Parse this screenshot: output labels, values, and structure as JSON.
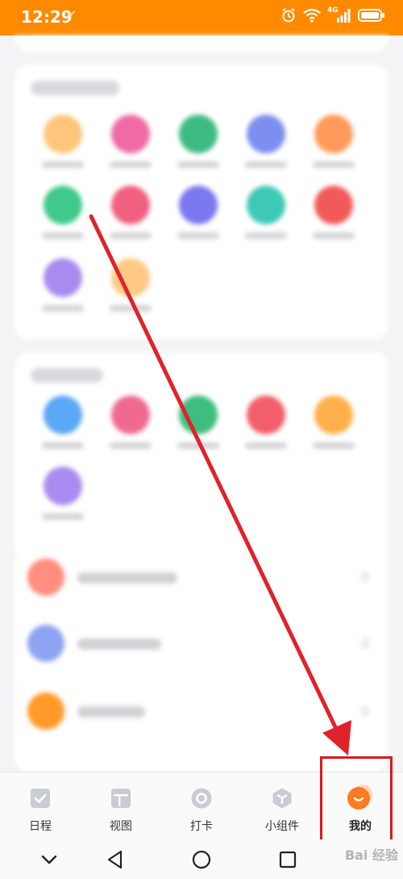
{
  "status_bar": {
    "time": "12:29",
    "network": "4G",
    "background": "#ff8a00"
  },
  "tab_bar": {
    "tabs": [
      {
        "label": "日程",
        "icon": "calendar-check-icon"
      },
      {
        "label": "视图",
        "icon": "layout-view-icon"
      },
      {
        "label": "打卡",
        "icon": "checkin-circle-icon"
      },
      {
        "label": "小组件",
        "icon": "widget-cube-icon"
      },
      {
        "label": "我的",
        "icon": "profile-face-icon",
        "active": true
      }
    ]
  },
  "annotation": {
    "arrow_color": "#e0222a",
    "box_color": "#d9181f"
  },
  "nav_bar": {
    "buttons": [
      "chevron-down-icon",
      "back-icon",
      "home-icon",
      "recents-icon"
    ]
  },
  "watermark": "Bai 经验"
}
